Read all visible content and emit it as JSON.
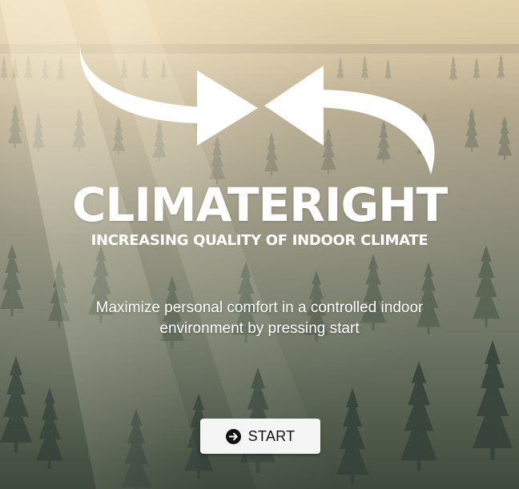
{
  "brand": {
    "title": "CLIMATERIGHT",
    "subtitle": "INCREASING QUALITY OF INDOOR CLIMATE"
  },
  "main": {
    "tagline": "Maximize personal comfort in a controlled indoor environment by pressing start",
    "start_label": "START"
  },
  "icons": {
    "logo": "converging-arrows-icon",
    "start": "arrow-circle-right-icon",
    "background": "misty-forest-image"
  },
  "colors": {
    "text": "#ffffff",
    "button_bg": "#f5f5f5",
    "button_text": "#111111"
  }
}
